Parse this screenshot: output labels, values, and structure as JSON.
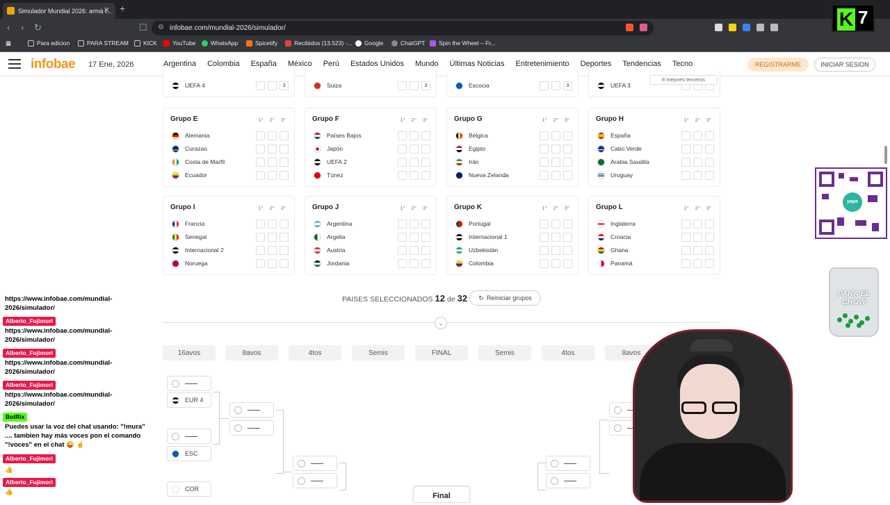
{
  "browser": {
    "tab_title": "Simulador Mundial 2026: armá t…",
    "new_tab": "+",
    "url": "infobae.com/mundial-2026/simulador/",
    "bookmarks": [
      "Para edicion",
      "PARA STREAM",
      "KICK",
      "YouTube",
      "WhatsApp",
      "Spicetify",
      "Recibidos (13.523) -...",
      "Google",
      "ChatGPT",
      "Spin the Wheel – Fr..."
    ]
  },
  "overlay": {
    "kick_letter": "K",
    "kick_number": "7"
  },
  "header": {
    "logo": "infobae",
    "date": "17 Ene, 2026",
    "nav": [
      "Argentina",
      "Colombia",
      "España",
      "México",
      "Perú",
      "Estados Unidos",
      "Mundo",
      "Últimas Noticias",
      "Entretenimiento",
      "Deportes",
      "Tendencias",
      "Tecno"
    ],
    "register": "REGISTRARME",
    "login": "INICIAR SESION"
  },
  "top_partial": {
    "rows": [
      {
        "team": "UEFA 4",
        "value": "3"
      },
      {
        "team": "Suiza",
        "value": "3"
      },
      {
        "team": "Escocia",
        "value": "3"
      },
      {
        "team": "UEFA 3",
        "value": ""
      }
    ],
    "thirds_badge": "8 mejores terceros"
  },
  "col_labels": [
    "1°",
    "2°",
    "3°"
  ],
  "groups": [
    {
      "name": "Grupo E",
      "teams": [
        "Alemania",
        "Curazao",
        "Costa de Marfil",
        "Ecuador"
      ]
    },
    {
      "name": "Grupo F",
      "teams": [
        "Países Bajos",
        "Japón",
        "UEFA 2",
        "Túnez"
      ]
    },
    {
      "name": "Grupo G",
      "teams": [
        "Bélgica",
        "Egipto",
        "Irán",
        "Nueva Zelanda"
      ]
    },
    {
      "name": "Grupo H",
      "teams": [
        "España",
        "Cabo Verde",
        "Arabia Saudita",
        "Uruguay"
      ]
    },
    {
      "name": "Grupo I",
      "teams": [
        "Francia",
        "Senegal",
        "Internacional 2",
        "Noruega"
      ]
    },
    {
      "name": "Grupo J",
      "teams": [
        "Argentina",
        "Argelia",
        "Austria",
        "Jordania"
      ]
    },
    {
      "name": "Grupo K",
      "teams": [
        "Portugal",
        "Internacional 1",
        "Uzbekistán",
        "Colombia"
      ]
    },
    {
      "name": "Grupo L",
      "teams": [
        "Inglaterra",
        "Croacia",
        "Ghana",
        "Panamá"
      ]
    }
  ],
  "selection": {
    "label": "PAISES SELECCIONADOS",
    "count": "12",
    "of": "de",
    "total": "32",
    "reset": "Reiniciar grupos"
  },
  "rounds": [
    "16avos",
    "8avos",
    "4tos",
    "Semis",
    "FINAL",
    "Semis",
    "4tos",
    "8avos"
  ],
  "bracket": {
    "slots": [
      "EUR 4",
      "ESC",
      "COR"
    ],
    "final_label": "Final"
  },
  "chat": [
    {
      "type": "msg",
      "text": "https://www.infobae.com/mundial-2026/simulador/"
    },
    {
      "type": "user",
      "text": "Alberto_Fujimori"
    },
    {
      "type": "msg",
      "text": "https://www.infobae.com/mundial-2026/simulador/"
    },
    {
      "type": "user",
      "text": "Alberto_Fujimori"
    },
    {
      "type": "msg",
      "text": "https://www.infobae.com/mundial-2026/simulador/"
    },
    {
      "type": "user",
      "text": "Alberto_Fujimori"
    },
    {
      "type": "msg",
      "text": "https://www.infobae.com/mundial-2026/simulador/"
    },
    {
      "type": "bot",
      "text": "BotRix"
    },
    {
      "type": "msg",
      "text": "Puedes usar la voz del chat usando: \"!mura\" .... tambien hay más voces pon el comando \"!voces\" en el chat 😜 ☝"
    },
    {
      "type": "user",
      "text": "Alberto_Fujimori"
    },
    {
      "type": "msg",
      "text": "👍"
    },
    {
      "type": "user",
      "text": "Alberto_Fujimori"
    },
    {
      "type": "msg",
      "text": "👍"
    }
  ],
  "side_overlay": {
    "qr_label": "yape",
    "jar_text": "PARA EL CHOW"
  },
  "colors": {
    "accent": "#f7941d",
    "chat_user": "#e6194b",
    "bot": "#53fc18"
  }
}
